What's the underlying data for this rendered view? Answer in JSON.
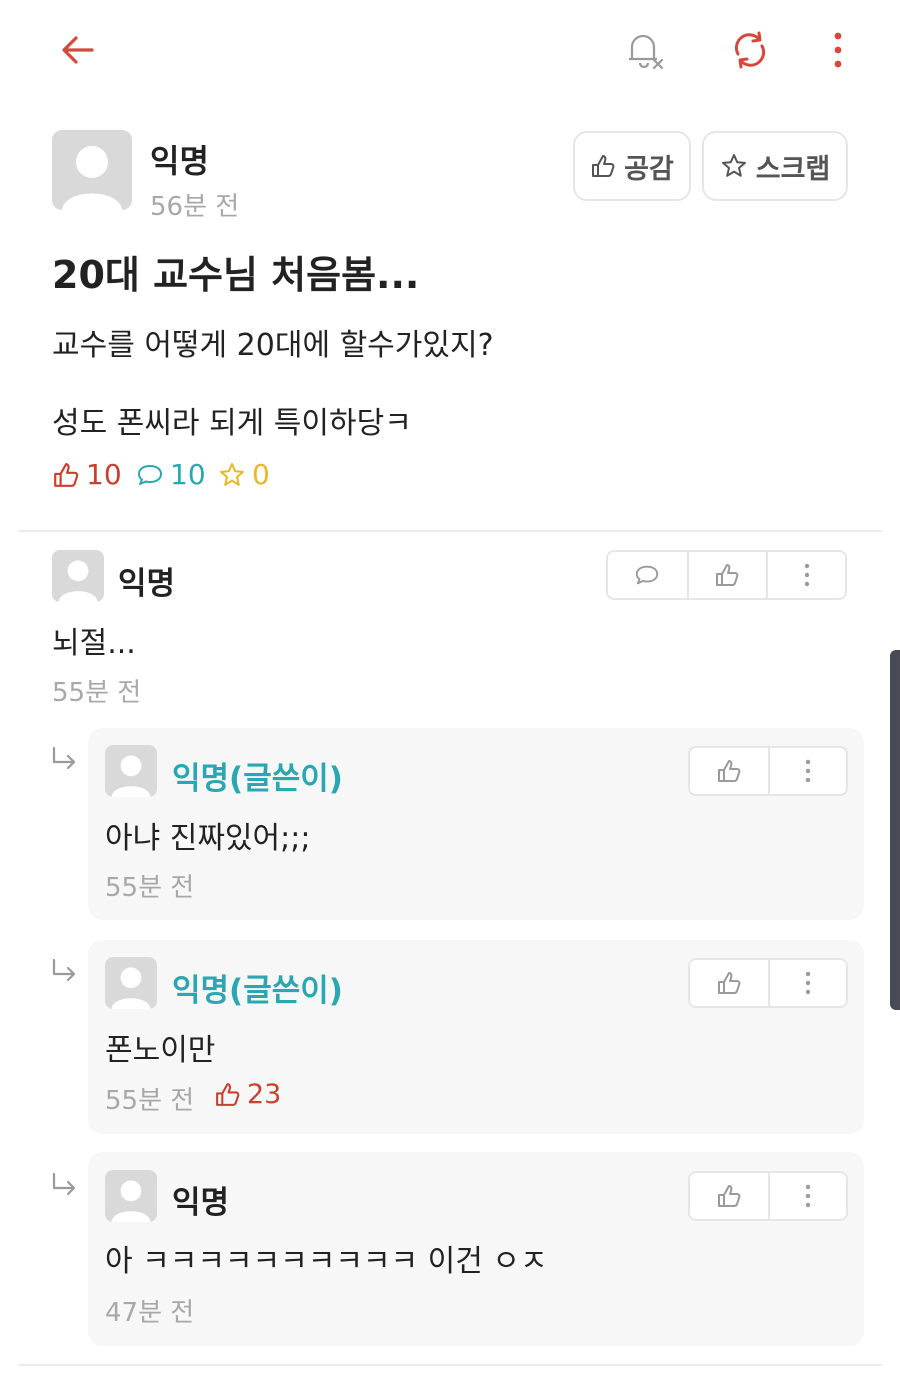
{
  "colors": {
    "accent": "#d5483a",
    "op_author": "#2aa7b0",
    "like": "#c8402f",
    "comment": "#2aa7b0",
    "scrap": "#e8b82a"
  },
  "topbar": {
    "back_icon": "arrow-left-icon",
    "notify_icon": "bell-off-icon",
    "refresh_icon": "refresh-icon",
    "more_icon": "more-vertical-icon"
  },
  "post": {
    "author": "익명",
    "time": "56분 전",
    "like_button": "공감",
    "scrap_button": "스크랩",
    "title": "20대 교수님 처음봄...",
    "body_line1": "교수를 어떻게 20대에 할수가있지?",
    "body_line2": "성도 폰씨라 되게 특이하당ㅋ",
    "like_count": "10",
    "comment_count": "10",
    "scrap_count": "0"
  },
  "comments": [
    {
      "author": "익명",
      "text": "뇌절...",
      "time": "55분 전",
      "reply": false
    },
    {
      "author": "익명(글쓴이)",
      "text": "아냐 진짜있어;;;",
      "time": "55분 전",
      "reply": true
    },
    {
      "author": "익명(글쓴이)",
      "text": "폰노이만",
      "time": "55분 전",
      "likes": "23",
      "reply": true
    },
    {
      "author": "익명",
      "text": "아 ㅋㅋㅋㅋㅋㅋㅋㅋㅋㅋ 이건 ㅇㅈ",
      "time": "47분 전",
      "reply": true
    }
  ]
}
